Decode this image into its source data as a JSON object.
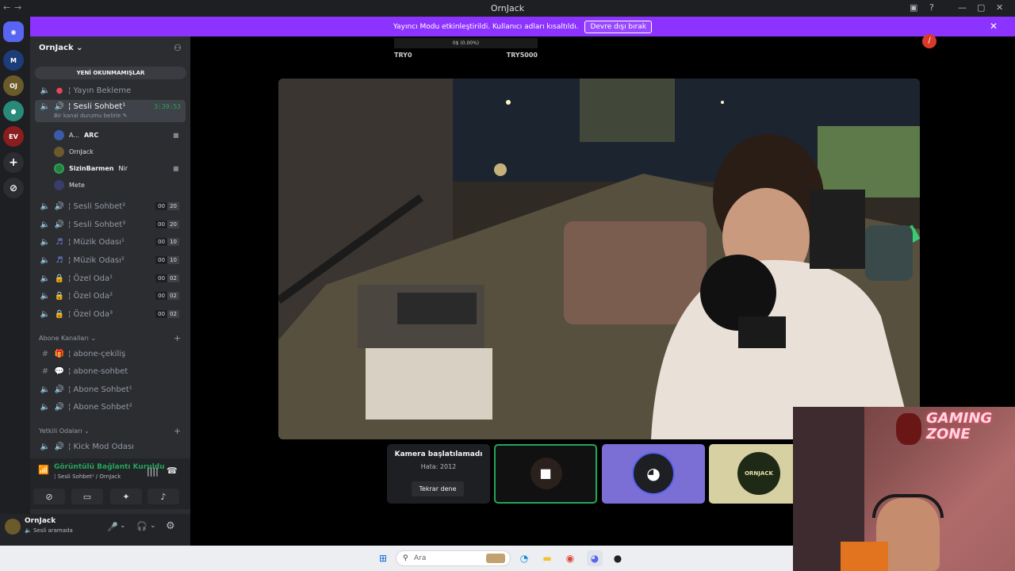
{
  "window": {
    "title": "OrnJack"
  },
  "banner": {
    "message": "Yayıncı Modu etkinleştirildi. Kullanıcı adları kısaltıldı.",
    "button": "Devre dışı bırak"
  },
  "guild": {
    "name": "OrnJack",
    "new_unread": "YENİ OKUNMAMIŞLAR"
  },
  "channels": {
    "yayin_bekleme": "¦ Yayın Bekleme",
    "active": {
      "label": "¦ Sesli Sohbet¹",
      "timer": "3:39:53",
      "status": "Bir kanal durumu belirle"
    },
    "users": [
      {
        "name": "A...",
        "tag": "ARC"
      },
      {
        "name": "OrnJack"
      },
      {
        "name": "SizinBarmen",
        "tag": "Nir"
      },
      {
        "name": "Mete"
      }
    ],
    "list": [
      {
        "label": "¦ Sesli Sohbet²",
        "count": "00",
        "limit": "20"
      },
      {
        "label": "¦ Sesli Sohbet³",
        "count": "00",
        "limit": "20"
      },
      {
        "label": "¦ Müzik Odası¹",
        "count": "00",
        "limit": "10"
      },
      {
        "label": "¦ Müzik Odası²",
        "count": "00",
        "limit": "10"
      },
      {
        "label": "¦ Özel Oda¹",
        "count": "00",
        "limit": "02"
      },
      {
        "label": "¦ Özel Oda²",
        "count": "00",
        "limit": "02"
      },
      {
        "label": "¦ Özel Oda³",
        "count": "00",
        "limit": "02"
      }
    ],
    "category_abone": "Abone Kanalları",
    "abone": [
      "¦ abone-çekiliş",
      "¦ abone-sohbet",
      "¦ Abone Sohbet¹",
      "¦ Abone Sohbet²"
    ],
    "category_yetkili": "Yetkili Odaları",
    "yetkili": [
      "¦ Kick Mod Odası"
    ]
  },
  "voice": {
    "status": "Görüntülü Bağlantı Kuruldu",
    "channel": "¦ Sesli Sohbet¹ / OrnJack"
  },
  "user_panel": {
    "name": "OrnJack",
    "state": "Sesli aramada"
  },
  "overlay": {
    "progress": "0$ (0.00%)",
    "left": "TRY0",
    "right": "TRY5000"
  },
  "camera_error": {
    "title": "Kamera başlatılamadı",
    "code": "Hata: 2012",
    "retry": "Tekrar dene"
  },
  "logo_text": "ORNJACK",
  "webcam_overlay": "GAMING ZONE",
  "taskbar": {
    "search": "Ara"
  },
  "colors": {
    "banner": "#8c33ff",
    "connected": "#23a55a",
    "discord": "#5865f2"
  }
}
